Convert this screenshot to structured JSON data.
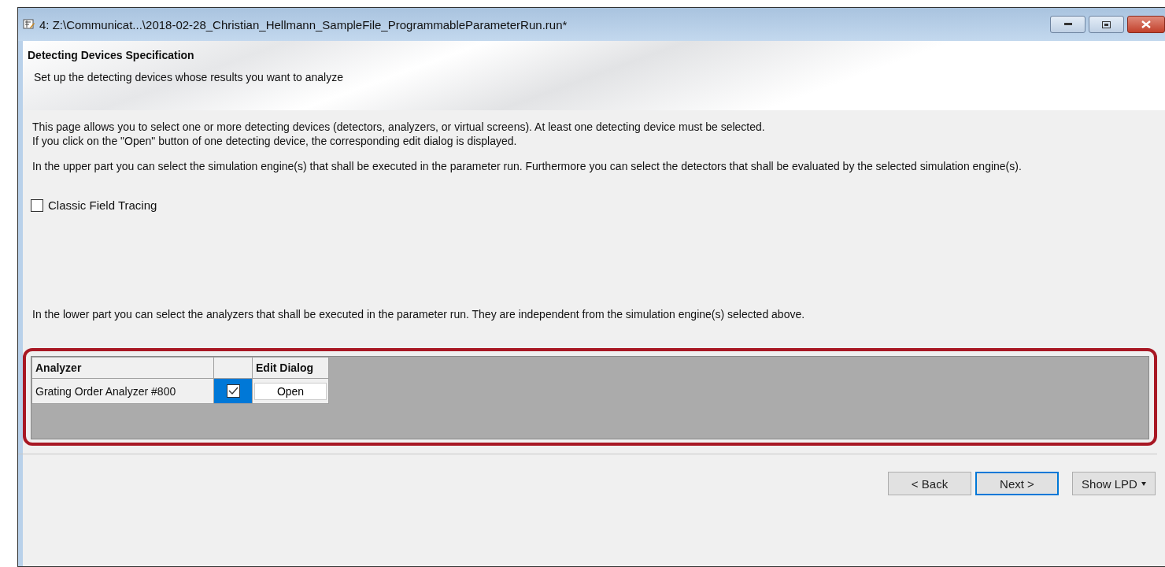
{
  "window": {
    "title": "4: Z:\\Communicat...\\2018-02-28_Christian_Hellmann_SampleFile_ProgrammableParameterRun.run*"
  },
  "header": {
    "title": "Detecting Devices Specification",
    "subtitle": "Set up the detecting devices whose results you want to analyze"
  },
  "intro": [
    "This page allows you to select one or more detecting devices (detectors, analyzers, or virtual screens). At least one detecting device must be selected.",
    "If you click on the \"Open\" button of one detecting device, the corresponding edit dialog is displayed."
  ],
  "upper_text": "In the upper part you can select the simulation engine(s) that shall be executed in the parameter run. Furthermore you can select the detectors that shall be evaluated by the selected simulation engine(s).",
  "engines": [
    {
      "label": "Classic Field Tracing",
      "checked": false
    }
  ],
  "lower_text": "In the lower part you can select the analyzers that shall be executed in the parameter run. They are independent from the simulation engine(s) selected above.",
  "table": {
    "columns": [
      "Analyzer",
      "",
      "Edit Dialog"
    ],
    "rows": [
      {
        "name": "Grating Order Analyzer #800",
        "checked": true,
        "selected": true,
        "action": "Open"
      }
    ]
  },
  "buttons": [
    {
      "label": "< Back",
      "default": false,
      "kind": "plain"
    },
    {
      "label": "Next >",
      "default": true,
      "kind": "plain"
    },
    {
      "label": "Show  LPD",
      "default": false,
      "kind": "menu"
    }
  ]
}
